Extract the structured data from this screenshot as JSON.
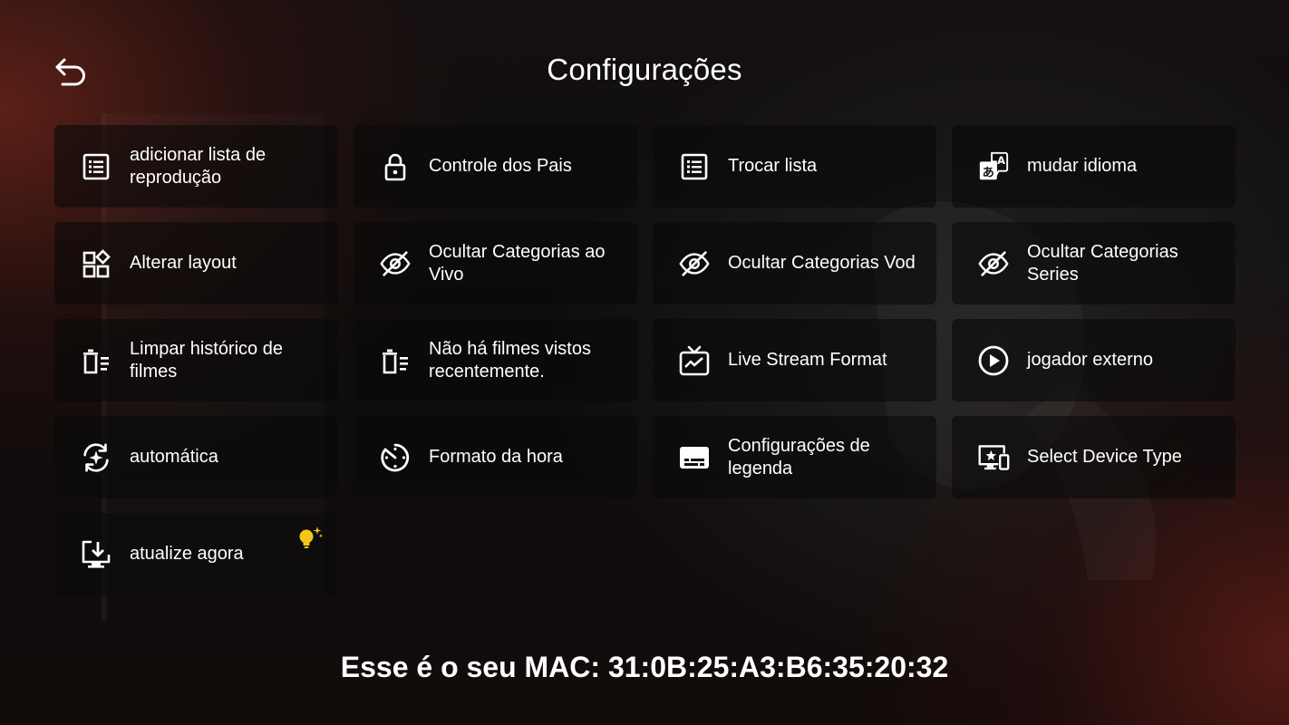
{
  "header": {
    "title": "Configurações",
    "back_icon": "back-arrow-icon"
  },
  "tiles": [
    {
      "label": "adicionar lista de reprodução",
      "icon": "playlist-add-icon"
    },
    {
      "label": "Controle dos Pais",
      "icon": "lock-icon"
    },
    {
      "label": "Trocar lista",
      "icon": "list-icon"
    },
    {
      "label": "mudar idioma",
      "icon": "translate-icon"
    },
    {
      "label": "Alterar layout",
      "icon": "layout-icon"
    },
    {
      "label": "Ocultar Categorias ao Vivo",
      "icon": "eye-off-icon"
    },
    {
      "label": "Ocultar Categorias Vod",
      "icon": "eye-off-icon"
    },
    {
      "label": "Ocultar Categorias Series",
      "icon": "eye-off-icon"
    },
    {
      "label": "Limpar histórico de filmes",
      "icon": "clear-history-icon"
    },
    {
      "label": "Não há filmes vistos recentemente.",
      "icon": "clear-history-icon"
    },
    {
      "label": "Live Stream Format",
      "icon": "live-tv-icon"
    },
    {
      "label": "jogador externo",
      "icon": "play-circle-icon"
    },
    {
      "label": "automática",
      "icon": "auto-refresh-icon"
    },
    {
      "label": "Formato da hora",
      "icon": "clock-icon"
    },
    {
      "label": "Configurações de legenda",
      "icon": "subtitles-icon"
    },
    {
      "label": "Select Device Type",
      "icon": "devices-icon"
    },
    {
      "label": "atualize agora",
      "icon": "download-update-icon",
      "badge_icon": "lightbulb-icon"
    }
  ],
  "footer": {
    "mac_text": "Esse é o seu MAC: 31:0B:25:A3:B6:35:20:32"
  },
  "colors": {
    "text": "#ffffff",
    "tile_background": "#0a0a0a",
    "badge": "#f5c518"
  }
}
